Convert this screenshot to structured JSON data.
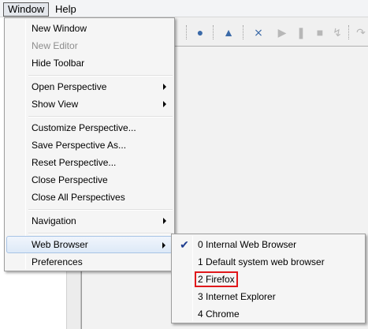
{
  "menubar": {
    "window": "Window",
    "help": "Help"
  },
  "window_menu": {
    "items": [
      {
        "label": "New Window",
        "enabled": true,
        "submenu": false
      },
      {
        "label": "New Editor",
        "enabled": false,
        "submenu": false
      },
      {
        "label": "Hide Toolbar",
        "enabled": true,
        "submenu": false
      },
      {
        "label": "Open Perspective",
        "enabled": true,
        "submenu": true
      },
      {
        "label": "Show View",
        "enabled": true,
        "submenu": true
      },
      {
        "label": "Customize Perspective...",
        "enabled": true,
        "submenu": false
      },
      {
        "label": "Save Perspective As...",
        "enabled": true,
        "submenu": false
      },
      {
        "label": "Reset Perspective...",
        "enabled": true,
        "submenu": false
      },
      {
        "label": "Close Perspective",
        "enabled": true,
        "submenu": false
      },
      {
        "label": "Close All Perspectives",
        "enabled": true,
        "submenu": false
      },
      {
        "label": "Navigation",
        "enabled": true,
        "submenu": true
      },
      {
        "label": "Web Browser",
        "enabled": true,
        "submenu": true,
        "highlighted": true
      },
      {
        "label": "Preferences",
        "enabled": true,
        "submenu": false
      }
    ]
  },
  "web_browser_submenu": {
    "items": [
      {
        "label": "0 Internal Web Browser",
        "checked": true
      },
      {
        "label": "1 Default system web browser",
        "checked": false
      },
      {
        "label": "2 Firefox",
        "checked": false,
        "annotated": true
      },
      {
        "label": "3 Internet Explorer",
        "checked": false
      },
      {
        "label": "4 Chrome",
        "checked": false
      }
    ]
  },
  "icons": {
    "check": "checkmark-icon",
    "globe": "globe-icon",
    "run_config": "run-config-icon",
    "skip_breakpoints": "skip-breakpoints-icon",
    "resume": "resume-icon",
    "suspend": "suspend-icon",
    "terminate": "terminate-icon",
    "disconnect": "disconnect-icon",
    "step_into": "step-into-icon"
  },
  "colors": {
    "annotation_red": "#e0181b",
    "highlight_border": "#a8c4e6",
    "check_blue": "#1e3d8f"
  }
}
